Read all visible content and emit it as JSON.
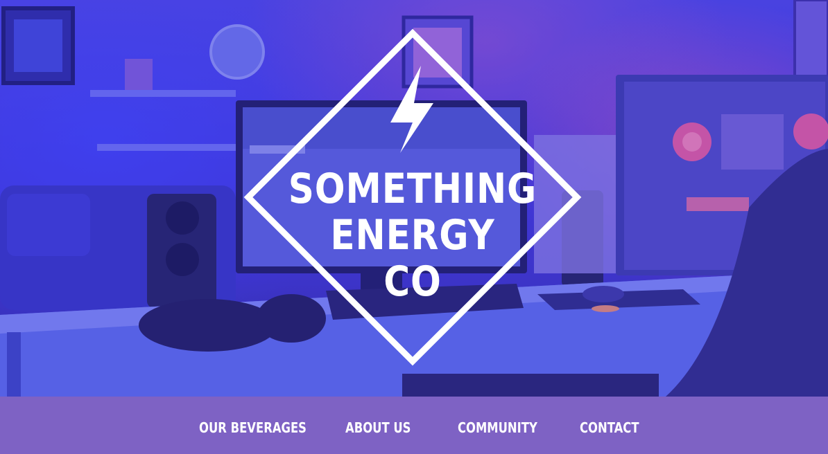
{
  "hero": {
    "background": "photo-gaming-desk-blue-overlay",
    "overlay_color": "#4a44e0"
  },
  "logo": {
    "icon": "lightning-bolt-icon",
    "line1": "SOMETHING",
    "line2": "ENERGY",
    "line3": "CO",
    "color": "#ffffff"
  },
  "nav": {
    "background": "#7e62c4",
    "items": [
      {
        "label": "OUR BEVERAGES"
      },
      {
        "label": "ABOUT US"
      },
      {
        "label": "COMMUNITY"
      },
      {
        "label": "CONTACT"
      }
    ]
  }
}
